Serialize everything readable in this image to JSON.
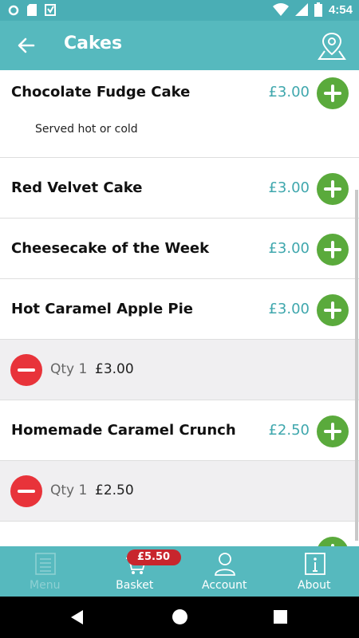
{
  "status_bar": {
    "time": "4:54"
  },
  "app_bar": {
    "title": "Cakes"
  },
  "items": [
    {
      "name": "Chocolate Fudge Cake",
      "price": "£3.00",
      "description": "Served hot or cold"
    },
    {
      "name": "Red Velvet Cake",
      "price": "£3.00"
    },
    {
      "name": "Cheesecake of the Week",
      "price": "£3.00"
    },
    {
      "name": "Hot Caramel Apple Pie",
      "price": "£3.00",
      "basket": {
        "qty": "Qty 1",
        "price": "£3.00"
      }
    },
    {
      "name": "Homemade Caramel Crunch",
      "price": "£2.50",
      "basket": {
        "qty": "Qty 1",
        "price": "£2.50"
      }
    }
  ],
  "bottom_nav": {
    "menu": "Menu",
    "basket": "Basket",
    "basket_badge": "£5.50",
    "account": "Account",
    "about": "About"
  },
  "colors": {
    "teal": "#56b9be",
    "price": "#3fa7ad",
    "add": "#5aaa3c",
    "remove": "#e8333a",
    "badge": "#c8262d"
  }
}
